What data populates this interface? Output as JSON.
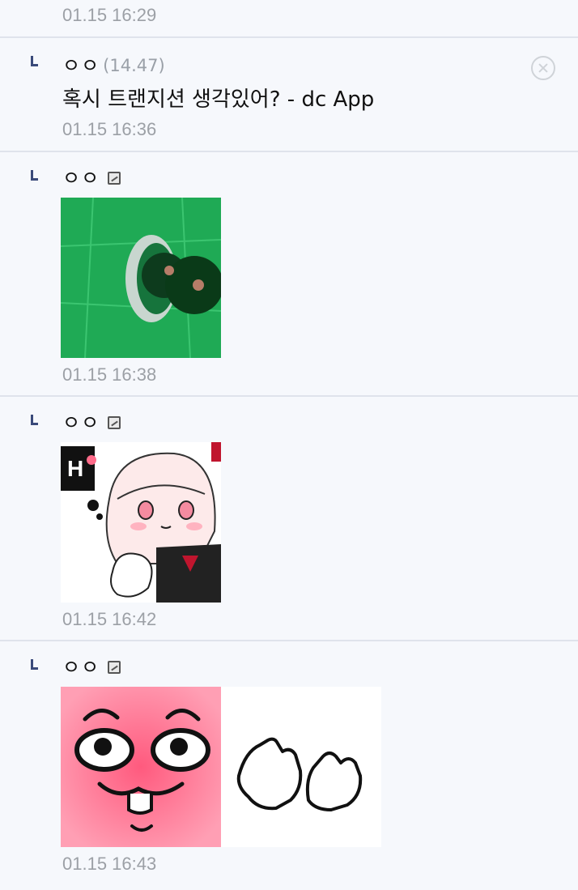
{
  "top_reply": {
    "date": "01.15 16:29"
  },
  "replies": [
    {
      "nickname": "ㅇㅇ",
      "ip": "(14.47)",
      "text": "혹시 트랜지션 생각있어? - dc App",
      "date": "01.15 16:36"
    },
    {
      "nickname": "ㅇㅇ",
      "dccon": "green-door-knob",
      "date": "01.15 16:38"
    },
    {
      "nickname": "ㅇㅇ",
      "dccon": "anime-girl-thinking",
      "date": "01.15 16:42"
    },
    {
      "nickname": "ㅇㅇ",
      "dccon": [
        "pink-face-sticker",
        "clapping-hands-sticker"
      ],
      "date": "01.15 16:43"
    }
  ]
}
